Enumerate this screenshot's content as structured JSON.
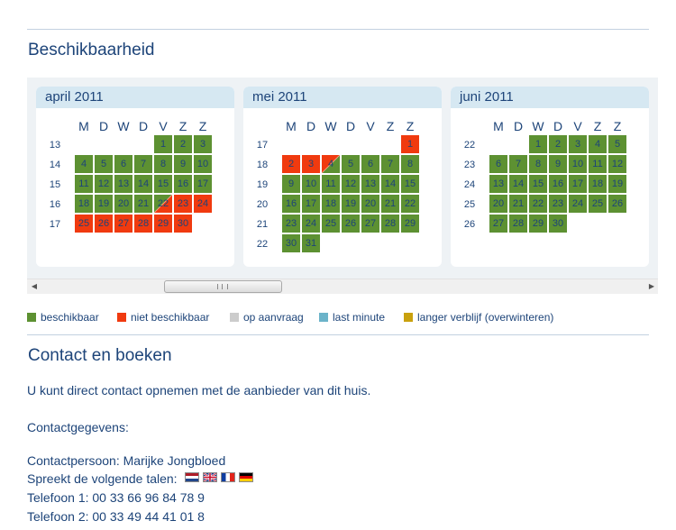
{
  "availability": {
    "title": "Beschikbaarheid",
    "dow": [
      "M",
      "D",
      "W",
      "D",
      "V",
      "Z",
      "Z"
    ],
    "months": [
      {
        "name": "april 2011",
        "weeks": [
          {
            "wk": "13",
            "days": [
              null,
              null,
              null,
              null,
              {
                "d": "1",
                "s": "a"
              },
              {
                "d": "2",
                "s": "a"
              },
              {
                "d": "3",
                "s": "a"
              }
            ]
          },
          {
            "wk": "14",
            "days": [
              {
                "d": "4",
                "s": "a"
              },
              {
                "d": "5",
                "s": "a"
              },
              {
                "d": "6",
                "s": "a"
              },
              {
                "d": "7",
                "s": "a"
              },
              {
                "d": "8",
                "s": "a"
              },
              {
                "d": "9",
                "s": "a"
              },
              {
                "d": "10",
                "s": "a"
              }
            ]
          },
          {
            "wk": "15",
            "days": [
              {
                "d": "11",
                "s": "a"
              },
              {
                "d": "12",
                "s": "a"
              },
              {
                "d": "13",
                "s": "a"
              },
              {
                "d": "14",
                "s": "a"
              },
              {
                "d": "15",
                "s": "a"
              },
              {
                "d": "16",
                "s": "a"
              },
              {
                "d": "17",
                "s": "a"
              }
            ]
          },
          {
            "wk": "16",
            "days": [
              {
                "d": "18",
                "s": "a"
              },
              {
                "d": "19",
                "s": "a"
              },
              {
                "d": "20",
                "s": "a"
              },
              {
                "d": "21",
                "s": "a"
              },
              {
                "d": "22",
                "s": "an"
              },
              {
                "d": "23",
                "s": "n"
              },
              {
                "d": "24",
                "s": "n"
              }
            ]
          },
          {
            "wk": "17",
            "days": [
              {
                "d": "25",
                "s": "n"
              },
              {
                "d": "26",
                "s": "n"
              },
              {
                "d": "27",
                "s": "n"
              },
              {
                "d": "28",
                "s": "n"
              },
              {
                "d": "29",
                "s": "n"
              },
              {
                "d": "30",
                "s": "n"
              },
              null
            ]
          }
        ]
      },
      {
        "name": "mei 2011",
        "weeks": [
          {
            "wk": "17",
            "days": [
              null,
              null,
              null,
              null,
              null,
              null,
              {
                "d": "1",
                "s": "n"
              }
            ]
          },
          {
            "wk": "18",
            "days": [
              {
                "d": "2",
                "s": "n"
              },
              {
                "d": "3",
                "s": "n"
              },
              {
                "d": "4",
                "s": "na"
              },
              {
                "d": "5",
                "s": "a"
              },
              {
                "d": "6",
                "s": "a"
              },
              {
                "d": "7",
                "s": "a"
              },
              {
                "d": "8",
                "s": "a"
              }
            ]
          },
          {
            "wk": "19",
            "days": [
              {
                "d": "9",
                "s": "a"
              },
              {
                "d": "10",
                "s": "a"
              },
              {
                "d": "11",
                "s": "a"
              },
              {
                "d": "12",
                "s": "a"
              },
              {
                "d": "13",
                "s": "a"
              },
              {
                "d": "14",
                "s": "a"
              },
              {
                "d": "15",
                "s": "a"
              }
            ]
          },
          {
            "wk": "20",
            "days": [
              {
                "d": "16",
                "s": "a"
              },
              {
                "d": "17",
                "s": "a"
              },
              {
                "d": "18",
                "s": "a"
              },
              {
                "d": "19",
                "s": "a"
              },
              {
                "d": "20",
                "s": "a"
              },
              {
                "d": "21",
                "s": "a"
              },
              {
                "d": "22",
                "s": "a"
              }
            ]
          },
          {
            "wk": "21",
            "days": [
              {
                "d": "23",
                "s": "a"
              },
              {
                "d": "24",
                "s": "a"
              },
              {
                "d": "25",
                "s": "a"
              },
              {
                "d": "26",
                "s": "a"
              },
              {
                "d": "27",
                "s": "a"
              },
              {
                "d": "28",
                "s": "a"
              },
              {
                "d": "29",
                "s": "a"
              }
            ]
          },
          {
            "wk": "22",
            "days": [
              {
                "d": "30",
                "s": "a"
              },
              {
                "d": "31",
                "s": "a"
              },
              null,
              null,
              null,
              null,
              null
            ]
          }
        ]
      },
      {
        "name": "juni 2011",
        "weeks": [
          {
            "wk": "22",
            "days": [
              null,
              null,
              {
                "d": "1",
                "s": "a"
              },
              {
                "d": "2",
                "s": "a"
              },
              {
                "d": "3",
                "s": "a"
              },
              {
                "d": "4",
                "s": "a"
              },
              {
                "d": "5",
                "s": "a"
              }
            ]
          },
          {
            "wk": "23",
            "days": [
              {
                "d": "6",
                "s": "a"
              },
              {
                "d": "7",
                "s": "a"
              },
              {
                "d": "8",
                "s": "a"
              },
              {
                "d": "9",
                "s": "a"
              },
              {
                "d": "10",
                "s": "a"
              },
              {
                "d": "11",
                "s": "a"
              },
              {
                "d": "12",
                "s": "a"
              }
            ]
          },
          {
            "wk": "24",
            "days": [
              {
                "d": "13",
                "s": "a"
              },
              {
                "d": "14",
                "s": "a"
              },
              {
                "d": "15",
                "s": "a"
              },
              {
                "d": "16",
                "s": "a"
              },
              {
                "d": "17",
                "s": "a"
              },
              {
                "d": "18",
                "s": "a"
              },
              {
                "d": "19",
                "s": "a"
              }
            ]
          },
          {
            "wk": "25",
            "days": [
              {
                "d": "20",
                "s": "a"
              },
              {
                "d": "21",
                "s": "a"
              },
              {
                "d": "22",
                "s": "a"
              },
              {
                "d": "23",
                "s": "a"
              },
              {
                "d": "24",
                "s": "a"
              },
              {
                "d": "25",
                "s": "a"
              },
              {
                "d": "26",
                "s": "a"
              }
            ]
          },
          {
            "wk": "26",
            "days": [
              {
                "d": "27",
                "s": "a"
              },
              {
                "d": "28",
                "s": "a"
              },
              {
                "d": "29",
                "s": "a"
              },
              {
                "d": "30",
                "s": "a"
              },
              null,
              null,
              null
            ]
          }
        ]
      }
    ]
  },
  "legend": [
    {
      "label": "beschikbaar",
      "color": "#5d9132"
    },
    {
      "label": "niet beschikbaar",
      "color": "#f03a0f"
    },
    {
      "label": "op aanvraag",
      "color": "#cccccc"
    },
    {
      "label": "last minute",
      "color": "#6bb3c9"
    },
    {
      "label": "langer verblijf (overwinteren)",
      "color": "#c9a10e"
    }
  ],
  "contact": {
    "title": "Contact en boeken",
    "intro": "U kunt direct contact opnemen met de aanbieder van dit huis.",
    "details_heading": "Contactgegevens:",
    "person": "Contactpersoon: Marijke Jongbloed",
    "languages_label": "Spreekt de volgende talen:",
    "languages": [
      "nl-flag-icon",
      "gb-flag-icon",
      "fr-flag-icon",
      "de-flag-icon"
    ],
    "phone1": "Telefoon 1: 00 33 66 96 84 78 9",
    "phone2": "Telefoon 2: 00 33 49 44 41 01 8"
  },
  "scrollbar": {
    "left_icon": "arrow-left-icon",
    "right_icon": "arrow-right-icon"
  }
}
